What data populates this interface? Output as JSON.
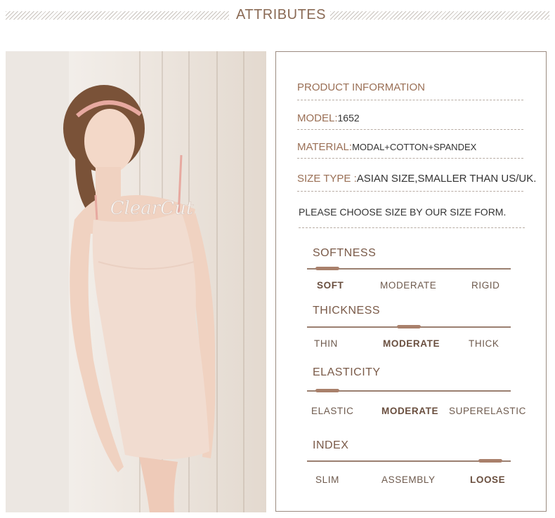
{
  "header": {
    "title": "ATTRIBUTES"
  },
  "product": {
    "section_title": "PRODUCT INFORMATION",
    "model_label": "MODEL:",
    "model_value": "1652",
    "material_label": "MATERIAL:",
    "material_value": "MODAL+COTTON+SPANDEX",
    "size_label": "SIZE TYPE :",
    "size_value": "ASIAN SIZE,SMALLER THAN US/UK.",
    "note": "PLEASE CHOOSE SIZE BY OUR SIZE FORM."
  },
  "photo": {
    "print_text": "ClearCut"
  },
  "scales": [
    {
      "title": "SOFTNESS",
      "options": [
        "SOFT",
        "MODERATE",
        "RIGID"
      ],
      "selected": 0,
      "level": 0.1
    },
    {
      "title": "THICKNESS",
      "options": [
        "THIN",
        "MODERATE",
        "THICK"
      ],
      "selected": 1,
      "level": 0.5
    },
    {
      "title": "ELASTICITY",
      "options": [
        "ELASTIC",
        "MODERATE",
        "SUPERELASTIC"
      ],
      "selected": 1,
      "level": 0.1
    },
    {
      "title": "INDEX",
      "options": [
        "SLIM",
        "ASSEMBLY",
        "LOOSE"
      ],
      "selected": 2,
      "level": 0.9
    }
  ],
  "colors": {
    "accent": "#8a6a55",
    "dress": "#f1dcd0",
    "strap": "#e7a9a0"
  }
}
